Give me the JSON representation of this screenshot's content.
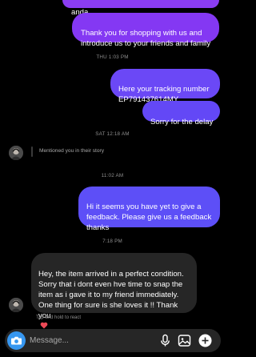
{
  "colors": {
    "sent_bubble_top": "#8b3df2",
    "sent_bubble_bottom": "#5f4ff6",
    "received_bubble": "#262626",
    "background": "#000000",
    "timestamp": "#8e8e8e",
    "camera_button": "#3797f0",
    "heart": "#ed4956"
  },
  "messages": {
    "sent_top_partial": "anda",
    "sent_shopping": "Thank you for shopping with us and introduce us to your friends and family",
    "sent_tracking": "Here your tracking number EP791437614MY",
    "sent_sorry": "Sorry for the delay",
    "sent_feedback": "Hi it seems you have yet to give a feedback. Please give us a feedback thanks",
    "received_reply": "Hey, the item arrived in a perfect condition. Sorry that i dont even hve time to snap the item as i gave it to my friend immediately. One thing for sure is she loves it !! Thank you",
    "received_reply_emoji": "heart-emoji"
  },
  "timestamps": {
    "t1": "THU 1:03 PM",
    "t2": "SAT 12:18 AM",
    "t3": "11:02 AM",
    "t4": "7:18 PM"
  },
  "story_mention": {
    "text": "Mentioned you in their story"
  },
  "hint": {
    "tap_hold": "Tap and hold to react"
  },
  "composer": {
    "placeholder": "Message...",
    "camera_icon": "camera-icon",
    "mic_icon": "microphone-icon",
    "gallery_icon": "gallery-icon",
    "add_icon": "plus-icon"
  }
}
